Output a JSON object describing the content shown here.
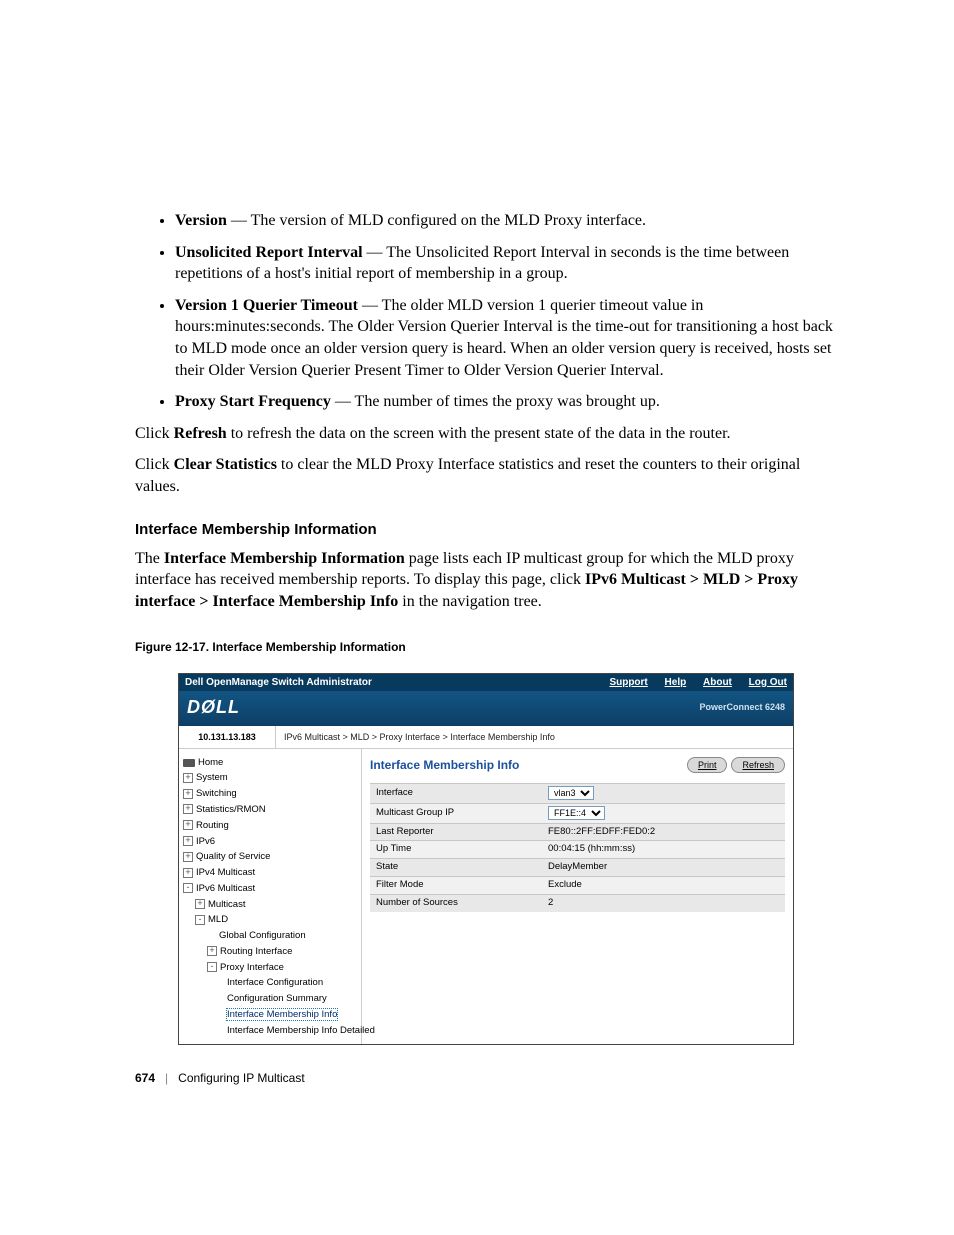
{
  "bullets": [
    {
      "term": "Version",
      "desc": " — The version of MLD configured on the MLD Proxy interface."
    },
    {
      "term": "Unsolicited Report Interval",
      "desc": " — The Unsolicited Report Interval in seconds is the time between repetitions of a host's initial report of membership in a group."
    },
    {
      "term": "Version 1 Querier Timeout",
      "desc": " — The older MLD version 1 querier timeout value in hours:minutes:seconds. The Older Version Querier Interval is the time-out for transitioning a host back to MLD mode once an older version query is heard. When an older version query is received, hosts set their Older Version Querier Present Timer to Older Version Querier Interval."
    },
    {
      "term": "Proxy Start Frequency",
      "desc": " — The number of times the proxy was brought up."
    }
  ],
  "click_refresh_pre": "Click ",
  "click_refresh_bold": "Refresh",
  "click_refresh_post": " to refresh the data on the screen with the present state of the data in the router.",
  "click_clear_pre": "Click ",
  "click_clear_bold": "Clear Statistics",
  "click_clear_post": " to clear the MLD Proxy Interface statistics and reset the counters to their original values.",
  "section_heading": "Interface Membership Information",
  "section_para_pre": "The ",
  "section_para_bold1": "Interface Membership Information",
  "section_para_mid": " page lists each IP multicast group for which the MLD proxy interface has received membership reports. To display this page, click ",
  "section_para_bold2": "IPv6 Multicast > MLD > Proxy interface > Interface Membership Info",
  "section_para_post": " in the navigation tree.",
  "figure_caption": "Figure 12-17.    Interface Membership Information",
  "shot": {
    "titlebar": "Dell OpenManage Switch Administrator",
    "links": {
      "support": "Support",
      "help": "Help",
      "about": "About",
      "logout": "Log Out"
    },
    "logo": "DØLL",
    "model": "PowerConnect 6248",
    "ip": "10.131.13.183",
    "breadcrumb": "IPv6 Multicast > MLD > Proxy Interface > Interface Membership Info",
    "tree": {
      "home": "Home",
      "system": "System",
      "switching": "Switching",
      "stats": "Statistics/RMON",
      "routing": "Routing",
      "ipv6": "IPv6",
      "qos": "Quality of Service",
      "ipv4m": "IPv4 Multicast",
      "ipv6m": "IPv6 Multicast",
      "multicast": "Multicast",
      "mld": "MLD",
      "global": "Global Configuration",
      "routingif": "Routing Interface",
      "proxy": "Proxy Interface",
      "ifcfg": "Interface Configuration",
      "cfgsum": "Configuration Summary",
      "imi": "Interface Membership Info",
      "imid": "Interface Membership Info Detailed"
    },
    "panel": {
      "title": "Interface Membership Info",
      "print": "Print",
      "refresh": "Refresh",
      "rows": {
        "r1l": "Interface",
        "r1v": "vlan3",
        "r2l": "Multicast Group IP",
        "r2v": "FF1E::4",
        "r3l": "Last Reporter",
        "r3v": "FE80::2FF:EDFF:FED0:2",
        "r4l": "Up Time",
        "r4v": "00:04:15  (hh:mm:ss)",
        "r5l": "State",
        "r5v": "DelayMember",
        "r6l": "Filter Mode",
        "r6v": "Exclude",
        "r7l": "Number of Sources",
        "r7v": "2"
      }
    }
  },
  "footer": {
    "page": "674",
    "chapter": "Configuring IP Multicast"
  }
}
